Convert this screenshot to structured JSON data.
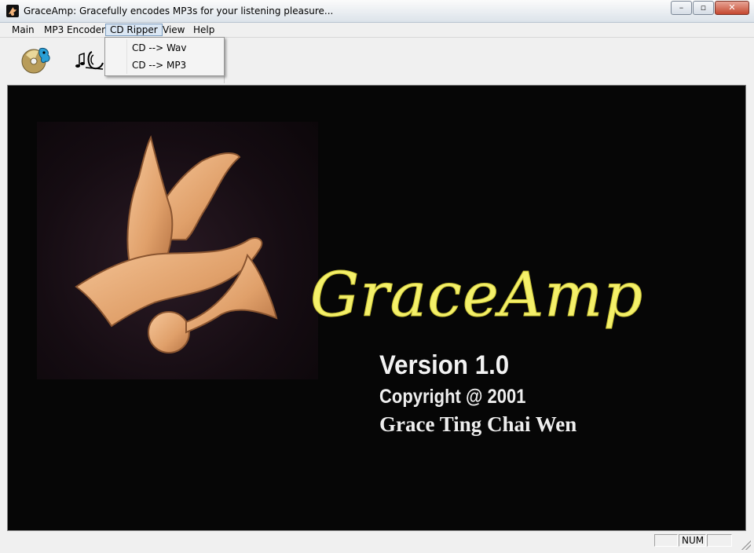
{
  "window": {
    "title": "GraceAmp:  Gracefully encodes MP3s for your listening pleasure...",
    "buttons": {
      "minimize": "–",
      "maximize": "▫",
      "close": "✕"
    }
  },
  "menu": {
    "items": [
      {
        "label": "Main"
      },
      {
        "label": "MP3 Encoder"
      },
      {
        "label": "CD Ripper",
        "active": true
      },
      {
        "label": "View"
      },
      {
        "label": "Help"
      }
    ]
  },
  "dropdown": {
    "items": [
      {
        "label": "CD --> Wav"
      },
      {
        "label": "CD --> MP3"
      }
    ]
  },
  "toolbar": {
    "buttons": [
      {
        "icon": "cd-ripper-icon"
      },
      {
        "icon": "mp3-encoder-icon"
      }
    ]
  },
  "splash": {
    "brand": "GraceAmp",
    "version": "Version 1.0",
    "copyright": "Copyright @ 2001",
    "author": "Grace Ting Chai Wen",
    "brand_color": "#f4f06a",
    "background_color": "#060606"
  },
  "statusbar": {
    "panels": [
      "",
      "NUM",
      ""
    ]
  }
}
